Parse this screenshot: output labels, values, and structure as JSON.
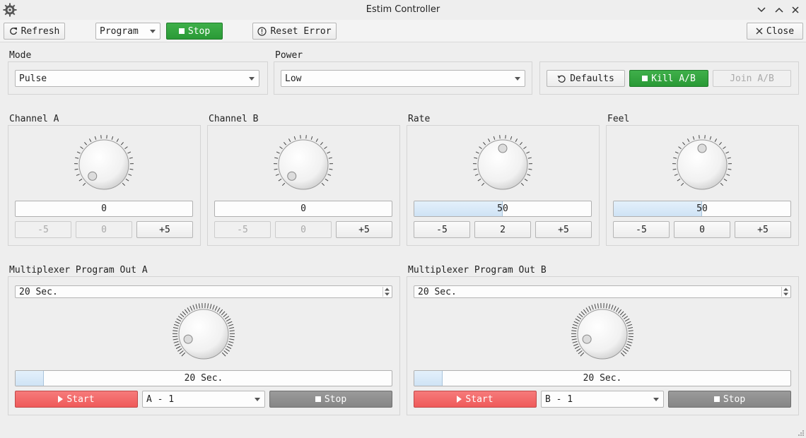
{
  "window": {
    "title": "Estim Controller"
  },
  "toolbar": {
    "refresh_label": "Refresh",
    "program_value": "Program",
    "stop_label": "Stop",
    "reset_error_label": "Reset Error",
    "close_label": "Close"
  },
  "mode": {
    "label": "Mode",
    "value": "Pulse"
  },
  "power": {
    "label": "Power",
    "value": "Low"
  },
  "actions": {
    "defaults_label": "Defaults",
    "kill_label": "Kill A/B",
    "join_label": "Join A/B"
  },
  "dials": [
    {
      "label": "Channel A",
      "value": "0",
      "level": 0,
      "minus": "-5",
      "step": "0",
      "plus": "+5",
      "controls_enabled": false
    },
    {
      "label": "Channel B",
      "value": "0",
      "level": 0,
      "minus": "-5",
      "step": "0",
      "plus": "+5",
      "controls_enabled": false
    },
    {
      "label": "Rate",
      "value": "50",
      "level": 50,
      "minus": "-5",
      "step": "2",
      "plus": "+5",
      "controls_enabled": true
    },
    {
      "label": "Feel",
      "value": "50",
      "level": 50,
      "minus": "-5",
      "step": "0",
      "plus": "+5",
      "controls_enabled": true
    }
  ],
  "multiplexers": [
    {
      "label": "Multiplexer Program Out A",
      "duration": "20 Sec.",
      "progress_text": "20 Sec.",
      "progress_percent": 7.5,
      "start_label": "Start",
      "channel": "A - 1",
      "stop_label": "Stop"
    },
    {
      "label": "Multiplexer Program Out B",
      "duration": "20 Sec.",
      "progress_text": "20 Sec.",
      "progress_percent": 7.5,
      "start_label": "Start",
      "channel": "B - 1",
      "stop_label": "Stop"
    }
  ],
  "colors": {
    "green": "#2fa63b",
    "red": "#f06464",
    "gray": "#8e8e8e",
    "progress_fill": "#d6e8f7"
  }
}
